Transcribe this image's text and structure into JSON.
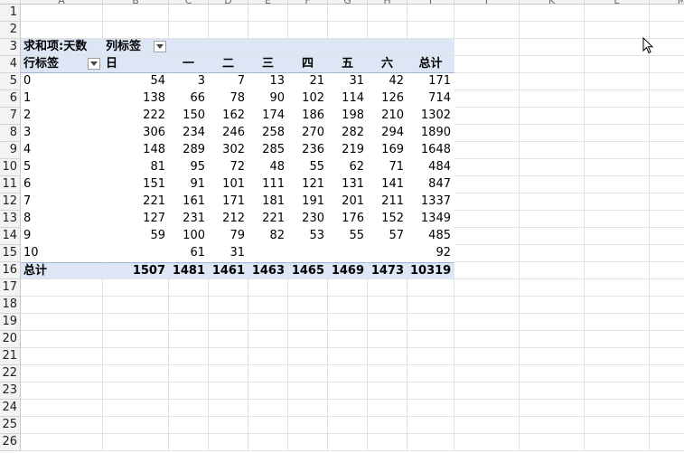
{
  "columns": [
    "A",
    "B",
    "C",
    "D",
    "E",
    "F",
    "G",
    "H",
    "I",
    "J",
    "K",
    "L",
    "M"
  ],
  "rows": [
    "1",
    "2",
    "3",
    "4",
    "5",
    "6",
    "7",
    "8",
    "9",
    "10",
    "11",
    "12",
    "13",
    "14",
    "15",
    "16",
    "17",
    "18",
    "19",
    "20",
    "21",
    "22",
    "23",
    "24",
    "25",
    "26"
  ],
  "pivot": {
    "title": "求和项:天数",
    "col_label": "列标签",
    "row_label": "行标签",
    "headers": [
      "日",
      "一",
      "二",
      "三",
      "四",
      "五",
      "六",
      "总计"
    ],
    "data": [
      [
        "0",
        "54",
        "3",
        "7",
        "13",
        "21",
        "31",
        "42",
        "171"
      ],
      [
        "1",
        "138",
        "66",
        "78",
        "90",
        "102",
        "114",
        "126",
        "714"
      ],
      [
        "2",
        "222",
        "150",
        "162",
        "174",
        "186",
        "198",
        "210",
        "1302"
      ],
      [
        "3",
        "306",
        "234",
        "246",
        "258",
        "270",
        "282",
        "294",
        "1890"
      ],
      [
        "4",
        "148",
        "289",
        "302",
        "285",
        "236",
        "219",
        "169",
        "1648"
      ],
      [
        "5",
        "81",
        "95",
        "72",
        "48",
        "55",
        "62",
        "71",
        "484"
      ],
      [
        "6",
        "151",
        "91",
        "101",
        "111",
        "121",
        "131",
        "141",
        "847"
      ],
      [
        "7",
        "221",
        "161",
        "171",
        "181",
        "191",
        "201",
        "211",
        "1337"
      ],
      [
        "8",
        "127",
        "231",
        "212",
        "221",
        "230",
        "176",
        "152",
        "1349"
      ],
      [
        "9",
        "59",
        "100",
        "79",
        "82",
        "53",
        "55",
        "57",
        "485"
      ],
      [
        "10",
        "",
        "61",
        "31",
        "",
        "",
        "",
        "",
        "92"
      ]
    ],
    "total": [
      "总计",
      "1507",
      "1481",
      "1461",
      "1463",
      "1465",
      "1469",
      "1473",
      "10319"
    ]
  }
}
